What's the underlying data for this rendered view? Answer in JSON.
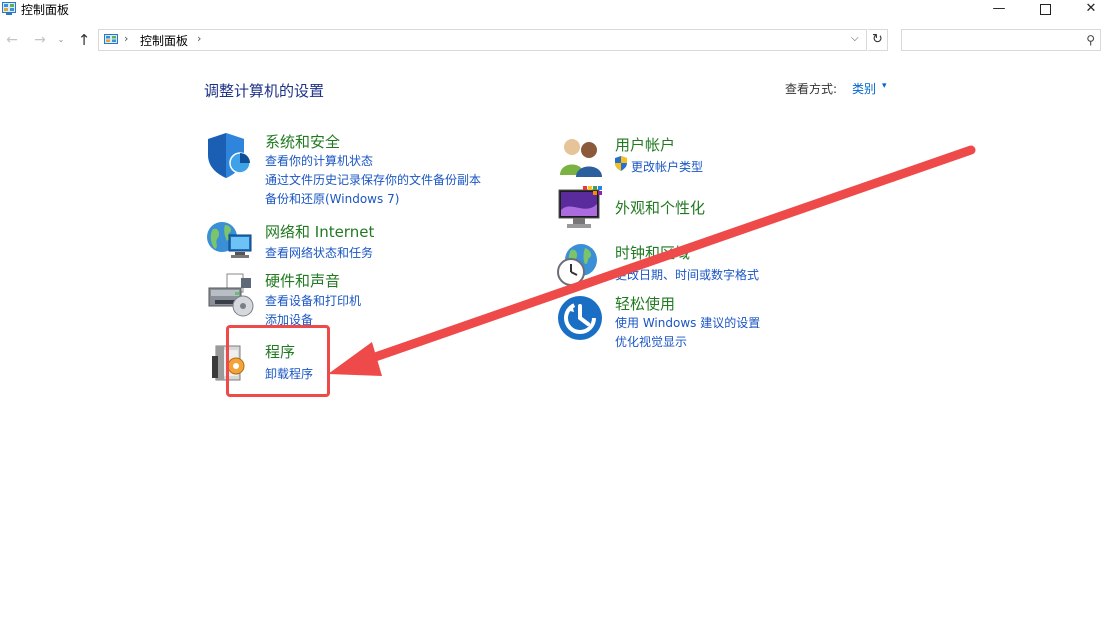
{
  "window": {
    "title": "控制面板",
    "buttons": {
      "minimize": "—",
      "maximize": "",
      "close": "✕"
    }
  },
  "nav": {
    "back_icon": "←",
    "forward_icon": "→",
    "recent_icon": "⌄",
    "up_icon": "↑",
    "address": {
      "sep": "›",
      "crumb": "控制面板",
      "dropdown": "⌵"
    },
    "refresh_icon": "↻",
    "search_placeholder": "",
    "search_icon": "⚲"
  },
  "content": {
    "heading": "调整计算机的设置",
    "view_by_label": "查看方式:",
    "view_by_value": "类别",
    "view_by_caret": "▾"
  },
  "categories": {
    "system": {
      "title": "系统和安全",
      "links": [
        "查看你的计算机状态",
        "通过文件历史记录保存你的文件备份副本",
        "备份和还原(Windows 7)"
      ]
    },
    "network": {
      "title": "网络和 Internet",
      "links": [
        "查看网络状态和任务"
      ]
    },
    "hardware": {
      "title": "硬件和声音",
      "links": [
        "查看设备和打印机",
        "添加设备"
      ]
    },
    "programs": {
      "title": "程序",
      "links": [
        "卸载程序"
      ]
    },
    "users": {
      "title": "用户帐户",
      "links": [
        "更改帐户类型"
      ]
    },
    "appearance": {
      "title": "外观和个性化",
      "links": []
    },
    "clock": {
      "title": "时钟和区域",
      "links": [
        "更改日期、时间或数字格式"
      ]
    },
    "ease": {
      "title": "轻松使用",
      "links": [
        "使用 Windows 建议的设置",
        "优化视觉显示"
      ]
    }
  },
  "colors": {
    "category_title": "#217a21",
    "link": "#1a56c4",
    "heading": "#1e3287",
    "annotation": "#ef4a4a"
  }
}
